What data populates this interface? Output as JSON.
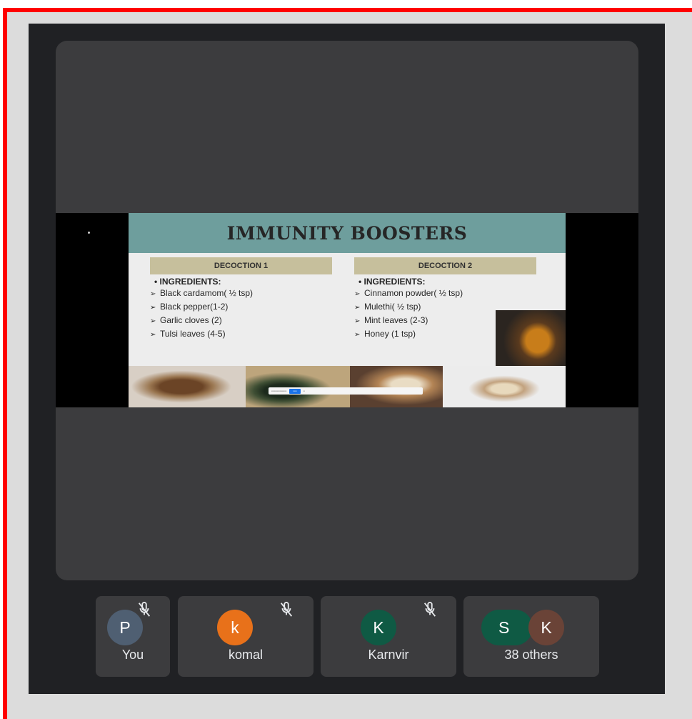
{
  "slide": {
    "title": "IMMUNITY BOOSTERS",
    "decoction1": {
      "heading": "DECOCTION 1",
      "ingredients_label": "•  INGREDIENTS:",
      "items": [
        "Black cardamom( ½ tsp)",
        "Black pepper(1-2)",
        "Garlic cloves (2)",
        "Tulsi leaves (4-5)"
      ]
    },
    "decoction2": {
      "heading": "DECOCTION 2",
      "ingredients_label": "•  INGREDIENTS:",
      "items": [
        "Cinnamon powder( ½ tsp)",
        "Mulethi( ½ tsp)",
        "Mint leaves (2-3)",
        "Honey (1 tsp)"
      ]
    },
    "bullet_glyph": "➢"
  },
  "participants": [
    {
      "initial": "P",
      "name": "You",
      "avatar_color": "#4f5f72",
      "muted": true
    },
    {
      "initial": "k",
      "name": "komal",
      "avatar_color": "#e8711a",
      "muted": true
    },
    {
      "initial": "K",
      "name": "Karnvir",
      "avatar_color": "#0f5a44",
      "muted": true
    },
    {
      "initials": [
        "S",
        "K"
      ],
      "name": "38 others",
      "avatar_colors": [
        "#0f5a44",
        "#6a4337"
      ]
    }
  ],
  "colors": {
    "frame_border": "#ff0000",
    "app_bg": "#202124",
    "tile_bg": "#3c3c3e"
  },
  "icons": {
    "muted": "mic-off-icon"
  }
}
